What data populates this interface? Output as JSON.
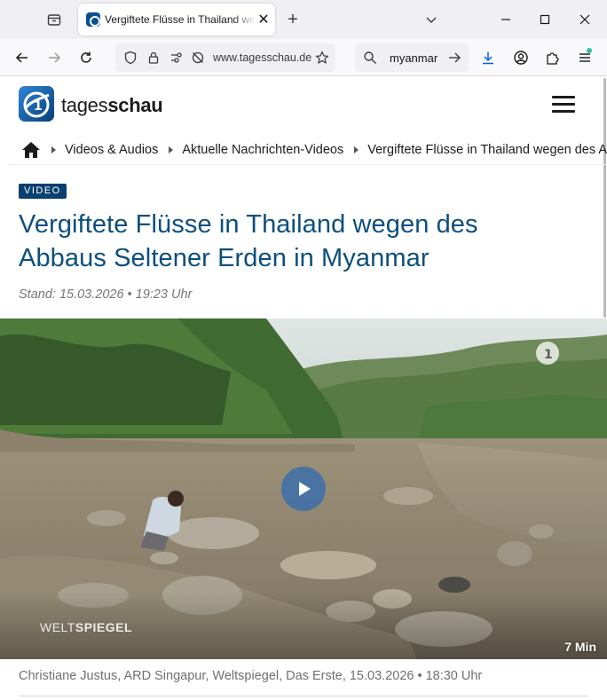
{
  "browser": {
    "tab_title": "Vergiftete Flüsse in Thailand wegen des Abbaus Seltener Erden in Myanmar",
    "new_tab_symbol": "+",
    "close_symbol": "✕",
    "url": "www.tagesschau.de",
    "search_query": "myanmar",
    "icons": {
      "tab_list": "tab-list-icon",
      "favicon": "tagesschau-favicon",
      "back": "back-arrow-icon",
      "forward": "forward-arrow-icon",
      "reload": "reload-icon",
      "shield": "shield-icon",
      "lock": "lock-icon",
      "permissions": "permissions-icon",
      "star": "star-icon",
      "search": "search-icon",
      "search_go": "arrow-right-icon",
      "download": "download-icon",
      "account": "account-icon",
      "extensions": "puzzle-icon",
      "menu": "hamburger-icon"
    }
  },
  "site": {
    "logo_text_light": "tages",
    "logo_text_bold": "schau",
    "breadcrumb": [
      "Videos & Audios",
      "Aktuelle Nachrichten-Videos",
      "Vergiftete Flüsse in Thailand wegen des Abbaus Seltener Erden in Myanmar"
    ]
  },
  "article": {
    "badge": "VIDEO",
    "headline": "Vergiftete Flüsse in Thailand wegen des Abbaus Seltener Erden in Myanmar",
    "stand": "Stand: 15.03.2026 • 19:23 Uhr",
    "video": {
      "watermark_light": "WELT",
      "watermark_bold": "SPIEGEL",
      "duration": "7 Min"
    },
    "caption": "Christiane Justus, ARD Singapur, Weltspiegel, Das Erste, 15.03.2026 • 18:30 Uhr"
  },
  "colors": {
    "headline": "#0c4f7e",
    "badge_bg": "#0a3f6f",
    "accent_blue": "#0061e0"
  }
}
